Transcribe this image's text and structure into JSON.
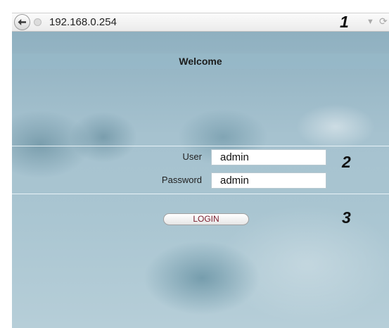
{
  "browser": {
    "url": "192.168.0.254"
  },
  "page": {
    "welcome": "Welcome",
    "user_label": "User",
    "user_value": "admin",
    "password_label": "Password",
    "password_value": "admin",
    "login_label": "LOGIN"
  },
  "callouts": [
    "1",
    "2",
    "3"
  ],
  "icons": {
    "back": "back-arrow-icon",
    "site": "site-info-icon",
    "dropdown": "dropdown-arrow-icon",
    "reload": "reload-icon"
  }
}
